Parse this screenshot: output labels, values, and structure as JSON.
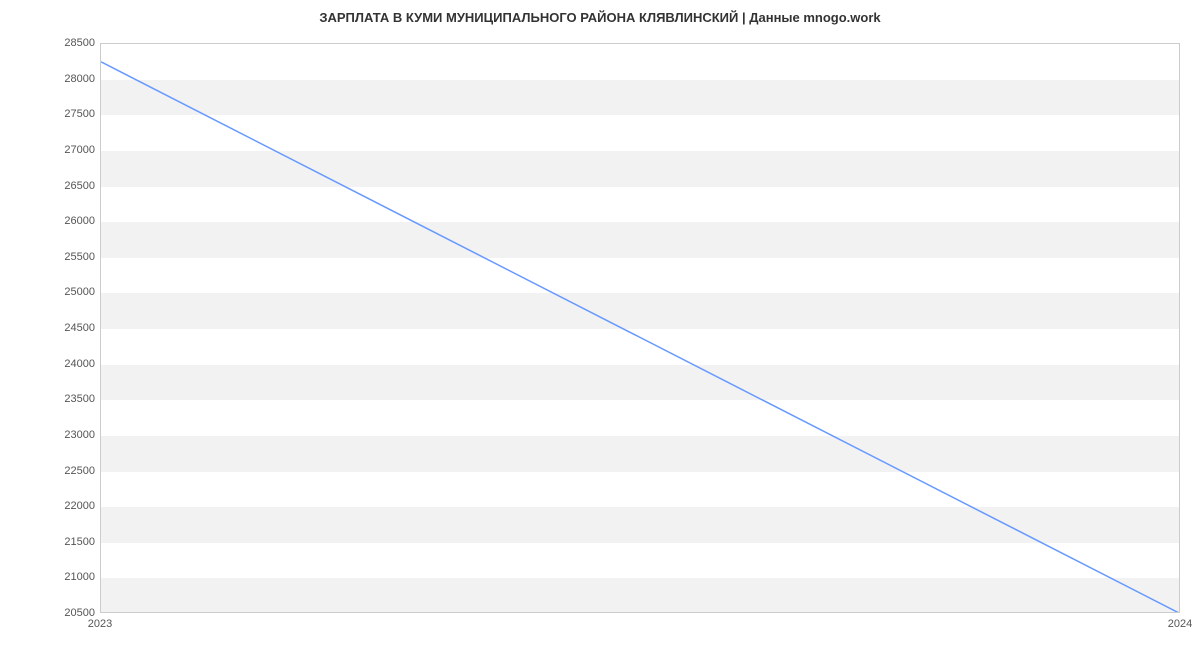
{
  "chart_data": {
    "type": "line",
    "title": "ЗАРПЛАТА В КУМИ МУНИЦИПАЛЬНОГО РАЙОНА КЛЯВЛИНСКИЙ | Данные mnogo.work",
    "x": [
      2023,
      2024
    ],
    "values": [
      28250,
      20500
    ],
    "x_ticks": [
      2023,
      2024
    ],
    "y_ticks": [
      20500,
      21000,
      21500,
      22000,
      22500,
      23000,
      23500,
      24000,
      24500,
      25000,
      25500,
      26000,
      26500,
      27000,
      27500,
      28000,
      28500
    ],
    "xlim": [
      2023,
      2024
    ],
    "ylim": [
      20500,
      28500
    ],
    "line_color": "#6699ff"
  }
}
